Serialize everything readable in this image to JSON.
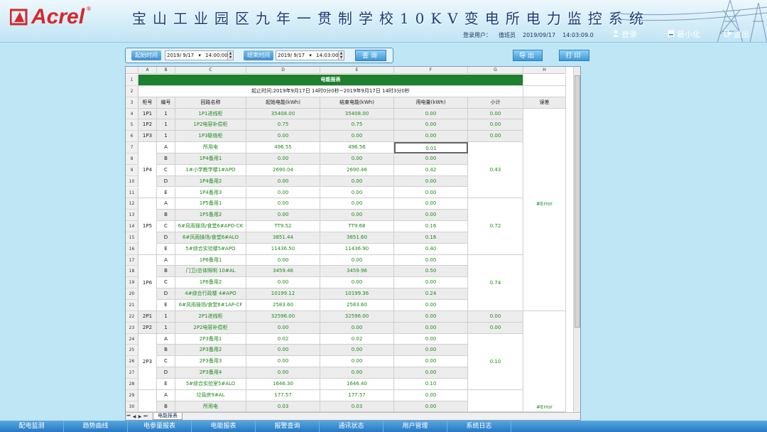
{
  "app": {
    "logo_text": "Acrel",
    "logo_mark": "®",
    "title": "宝山工业园区九年一贯制学校10KV变电所电力监控系统"
  },
  "header": {
    "user_label": "登录用户：",
    "user_name": "值班员",
    "date": "2019/09/17",
    "time": "14:03:09.0",
    "login": "登录",
    "minimize": "最小化",
    "exit": "退出"
  },
  "toolbar": {
    "start_label": "起始时间",
    "start_date": "2019/ 9/17",
    "start_time": "14:00:00",
    "end_label": "结束时间",
    "end_date": "2019/ 9/17",
    "end_time": "14:03:00",
    "query": "查询",
    "export": "导出",
    "print": "打印"
  },
  "sheet": {
    "col_letters": [
      "A",
      "B",
      "C",
      "D",
      "E",
      "F",
      "G",
      "H"
    ],
    "title": "电能报表",
    "subtitle": "起止时间:2019年9月17日 14时0分0秒~2019年9月17日 14时3分0秒",
    "headers": [
      "柜号",
      "编号",
      "回路名称",
      "起始电能(kWh)",
      "结束电能(kWh)",
      "用电量(kWh)",
      "小计",
      "误差"
    ],
    "groups": [
      {
        "cabinet": "1P1",
        "subtotal": "0.00",
        "rows": [
          {
            "no": "1",
            "name": "1P1进线柜",
            "start": "35408.00",
            "end": "35408.00",
            "usage": "0.00"
          }
        ]
      },
      {
        "cabinet": "1P2",
        "subtotal": "0.00",
        "rows": [
          {
            "no": "1",
            "name": "1P2电容补偿柜",
            "start": "0.75",
            "end": "0.75",
            "usage": "0.00"
          }
        ]
      },
      {
        "cabinet": "1P3",
        "subtotal": "0.00",
        "rows": [
          {
            "no": "1",
            "name": "1P3联络柜",
            "start": "0.00",
            "end": "0.00",
            "usage": "0.00"
          }
        ]
      },
      {
        "cabinet": "1P4",
        "subtotal": "0.43",
        "rows": [
          {
            "no": "A",
            "name": "所用电",
            "start": "496.55",
            "end": "496.56",
            "usage": "0.01"
          },
          {
            "no": "B",
            "name": "1P4备用1",
            "start": "0.00",
            "end": "0.00",
            "usage": "0.00"
          },
          {
            "no": "C",
            "name": "1#小学教学楼1#APO",
            "start": "2690.04",
            "end": "2690.46",
            "usage": "0.42"
          },
          {
            "no": "D",
            "name": "1P4备用2",
            "start": "0.00",
            "end": "0.00",
            "usage": "0.00"
          },
          {
            "no": "E",
            "name": "1P4备用3",
            "start": "0.00",
            "end": "0.00",
            "usage": "0.00"
          }
        ]
      },
      {
        "cabinet": "1P5",
        "subtotal": "0.72",
        "rows": [
          {
            "no": "A",
            "name": "1P5备用1",
            "start": "0.00",
            "end": "0.00",
            "usage": "0.00"
          },
          {
            "no": "B",
            "name": "1P5备用2",
            "start": "0.00",
            "end": "0.00",
            "usage": "0.00"
          },
          {
            "no": "C",
            "name": "6#风雨操场/食堂6#APO-CK",
            "start": "TT9.52",
            "end": "TT9.68",
            "usage": "0.16"
          },
          {
            "no": "D",
            "name": "6#风雨操场/食堂6#ALO",
            "start": "3851.44",
            "end": "3851.60",
            "usage": "0.16"
          },
          {
            "no": "E",
            "name": "5#综合实验楼5#APO",
            "start": "11436.50",
            "end": "11436.90",
            "usage": "0.40"
          }
        ]
      },
      {
        "cabinet": "1P6",
        "subtotal": "0.74",
        "rows": [
          {
            "no": "A",
            "name": "1P6备用1",
            "start": "0.00",
            "end": "0.00",
            "usage": "0.00"
          },
          {
            "no": "B",
            "name": "门卫/总体照明 10#AL",
            "start": "3459.46",
            "end": "3459.96",
            "usage": "0.50"
          },
          {
            "no": "C",
            "name": "1P6备用2",
            "start": "0.00",
            "end": "0.00",
            "usage": "0.00"
          },
          {
            "no": "D",
            "name": "4#综合行政楼 4#APO",
            "start": "10199.12",
            "end": "10199.36",
            "usage": "0.24"
          },
          {
            "no": "E",
            "name": "6#风雨操场/食堂6#1AP-CF",
            "start": "2583.60",
            "end": "2583.60",
            "usage": "0.00"
          }
        ]
      },
      {
        "cabinet": "2P1",
        "subtotal": "0.00",
        "rows": [
          {
            "no": "1",
            "name": "2P1进线柜",
            "start": "32596.00",
            "end": "32596.00",
            "usage": "0.00"
          }
        ]
      },
      {
        "cabinet": "2P2",
        "subtotal": "0.00",
        "rows": [
          {
            "no": "1",
            "name": "2P2电容补偿柜",
            "start": "0.00",
            "end": "0.00",
            "usage": "0.00"
          }
        ]
      },
      {
        "cabinet": "2P3",
        "subtotal": "0.10",
        "rows": [
          {
            "no": "A",
            "name": "2P3备用1",
            "start": "0.02",
            "end": "0.02",
            "usage": "0.00"
          },
          {
            "no": "B",
            "name": "2P3备用2",
            "start": "0.00",
            "end": "0.00",
            "usage": "0.00"
          },
          {
            "no": "C",
            "name": "2P3备用3",
            "start": "0.00",
            "end": "0.00",
            "usage": "0.00"
          },
          {
            "no": "D",
            "name": "2P3备用4",
            "start": "0.00",
            "end": "0.00",
            "usage": "0.00"
          },
          {
            "no": "E",
            "name": "5#综合实验室5#ALO",
            "start": "1646.30",
            "end": "1646.40",
            "usage": "0.10"
          }
        ]
      },
      {
        "cabinet": "",
        "subtotal": "",
        "rows": [
          {
            "no": "A",
            "name": "垃圾房9#AL",
            "start": "177.57",
            "end": "177.57",
            "usage": "0.00"
          },
          {
            "no": "B",
            "name": "所用电",
            "start": "0.03",
            "end": "0.03",
            "usage": "0.00"
          }
        ]
      }
    ],
    "error_text": "#Error",
    "sheet_tab": "电能报表"
  },
  "nav": [
    "配电监测",
    "趋势曲线",
    "电参量报表",
    "电能报表",
    "报警查询",
    "通讯状态",
    "用户管理",
    "系统日志"
  ]
}
